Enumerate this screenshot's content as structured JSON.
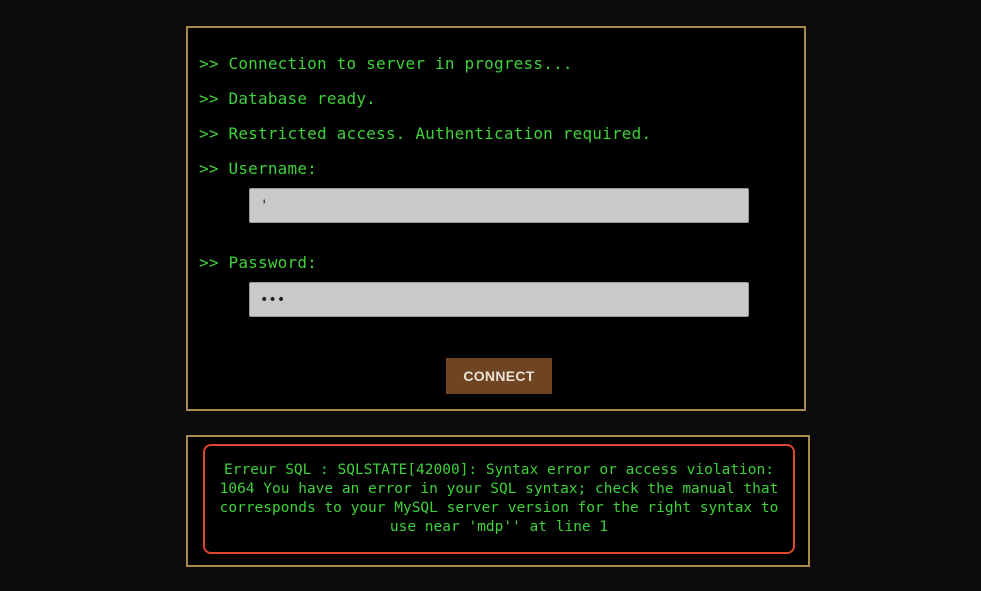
{
  "terminal": {
    "lines": [
      ">> Connection to server in progress...",
      ">> Database ready.",
      ">> Restricted access. Authentication required.",
      ">> Username:",
      ">> Password:"
    ],
    "username_value": "'",
    "password_value": "•••",
    "connect_label": "CONNECT"
  },
  "error": {
    "message": "Erreur SQL : SQLSTATE[42000]: Syntax error or access violation: 1064 You have an error in your SQL syntax; check the manual that corresponds to your MySQL server version for the right syntax to use near 'mdp'' at line 1"
  },
  "colors": {
    "background": "#0b0b0b",
    "terminal_text": "#3fd13a",
    "frame_border": "#a88a4a",
    "button_bg": "#6f4422",
    "error_border": "#e0452f"
  }
}
